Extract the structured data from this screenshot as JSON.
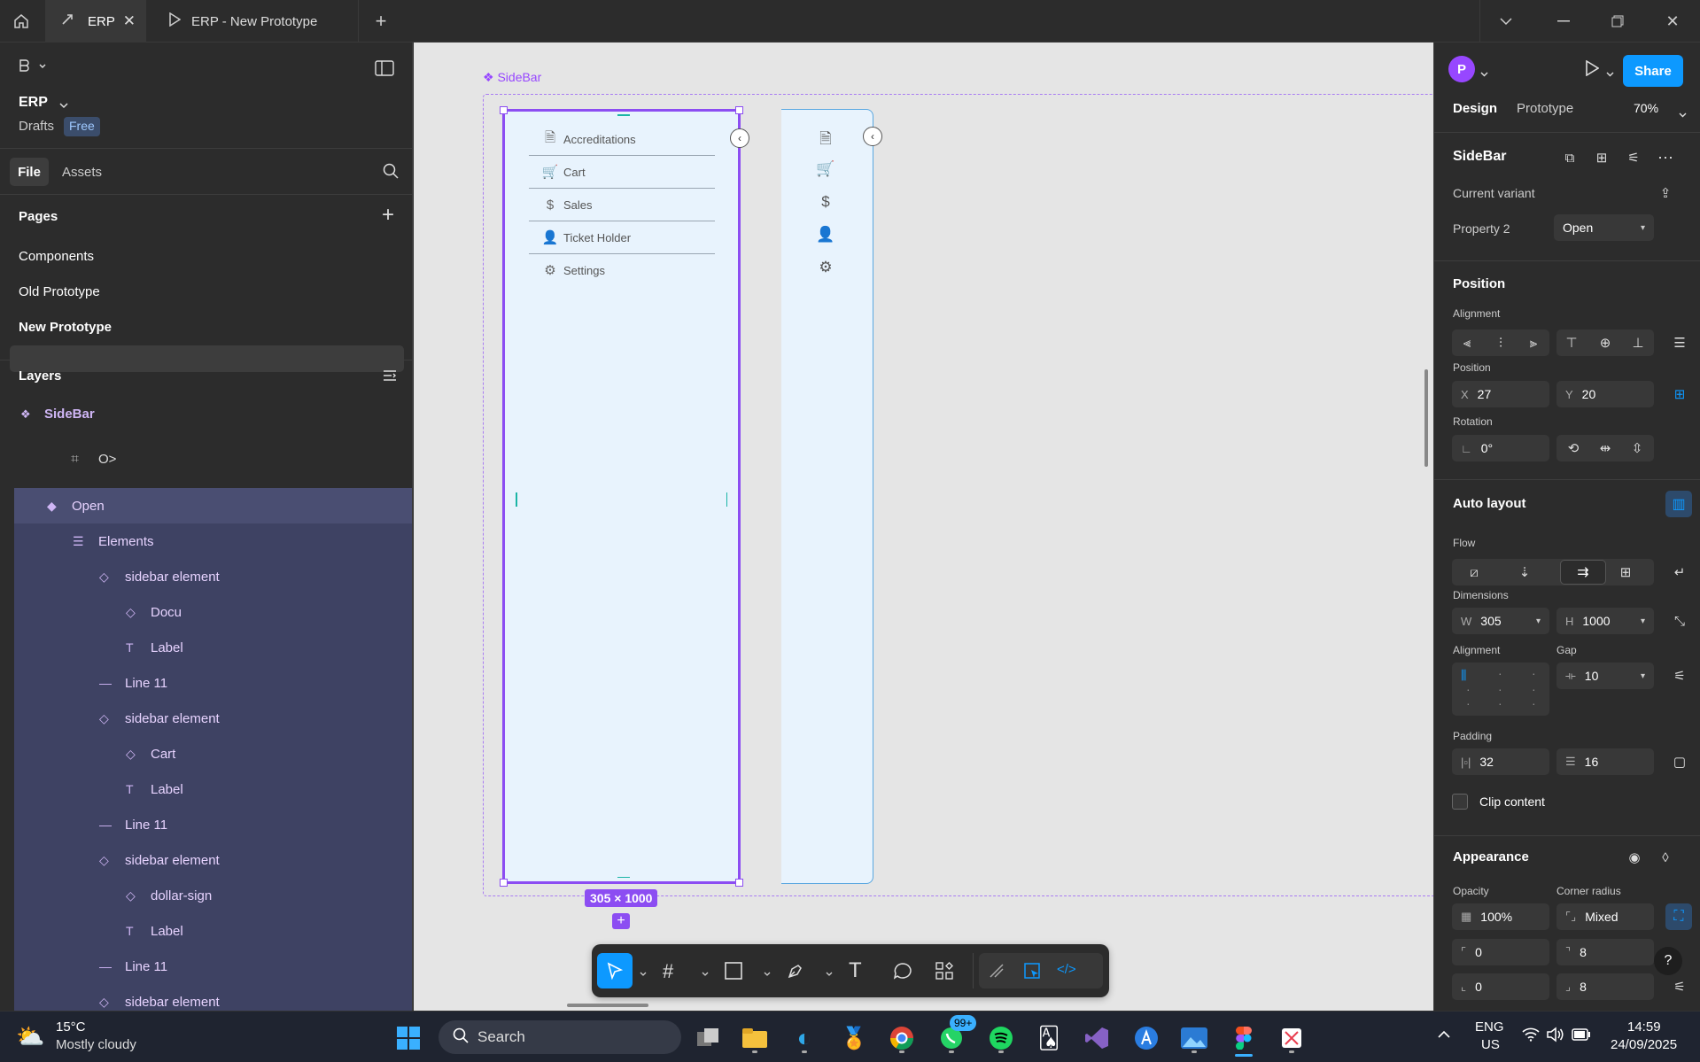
{
  "titlebar": {
    "tabs": [
      {
        "label": "ERP",
        "active": true
      },
      {
        "label": "ERP - New Prototype",
        "active": false
      }
    ]
  },
  "file": {
    "name": "ERP",
    "location": "Drafts",
    "plan_badge": "Free"
  },
  "left_tabs": {
    "file": "File",
    "assets": "Assets"
  },
  "pages": {
    "heading": "Pages",
    "items": [
      "Components",
      "Old Prototype",
      "New Prototype"
    ],
    "selected": "New Prototype"
  },
  "layers": {
    "heading": "Layers",
    "root": "SideBar",
    "items": [
      {
        "label": "O>",
        "icon": "frame-icon"
      },
      {
        "label": "Open",
        "icon": "component-icon"
      },
      {
        "label": "Elements",
        "icon": "autolayout-icon"
      },
      {
        "label": "sidebar element",
        "icon": "instance-icon"
      },
      {
        "label": "Docu",
        "icon": "instance-icon"
      },
      {
        "label": "Label",
        "icon": "text-icon"
      },
      {
        "label": "Line 11",
        "icon": "line-icon"
      },
      {
        "label": "sidebar element",
        "icon": "instance-icon"
      },
      {
        "label": "Cart",
        "icon": "instance-icon"
      },
      {
        "label": "Label",
        "icon": "text-icon"
      },
      {
        "label": "Line 11",
        "icon": "line-icon"
      },
      {
        "label": "sidebar element",
        "icon": "instance-icon"
      },
      {
        "label": "dollar-sign",
        "icon": "instance-icon"
      },
      {
        "label": "Label",
        "icon": "text-icon"
      },
      {
        "label": "Line 11",
        "icon": "line-icon"
      },
      {
        "label": "sidebar element",
        "icon": "instance-icon"
      }
    ]
  },
  "canvas": {
    "component_label": "SideBar",
    "open_items": [
      {
        "label": "Accreditations",
        "icon": "document-icon"
      },
      {
        "label": "Cart",
        "icon": "cart-icon"
      },
      {
        "label": "Sales",
        "icon": "dollar-icon"
      },
      {
        "label": "Ticket Holder",
        "icon": "user-icon"
      },
      {
        "label": "Settings",
        "icon": "gear-icon"
      }
    ],
    "size_badge": "305 × 1000"
  },
  "right": {
    "avatar_letter": "P",
    "share_label": "Share",
    "tabs": {
      "design": "Design",
      "prototype": "Prototype"
    },
    "zoom": "70%",
    "selection_name": "SideBar",
    "current_variant": "Current variant",
    "property_label": "Property 2",
    "property_value": "Open",
    "position_heading": "Position",
    "alignment_label": "Alignment",
    "position_label": "Position",
    "x": "27",
    "y": "20",
    "rotation_label": "Rotation",
    "rotation": "0°",
    "autolayout_heading": "Auto layout",
    "flow_label": "Flow",
    "dimensions_label": "Dimensions",
    "w": "305",
    "h": "1000",
    "alignment2_label": "Alignment",
    "gap_label": "Gap",
    "gap": "10",
    "padding_label": "Padding",
    "padding_h": "32",
    "padding_v": "16",
    "clip_content": "Clip content",
    "appearance_heading": "Appearance",
    "opacity_label": "Opacity",
    "opacity": "100%",
    "corner_label": "Corner radius",
    "corner": "Mixed",
    "r_tl": "0",
    "r_tr": "8",
    "r_bl": "0",
    "r_br": "8"
  },
  "taskbar": {
    "temp": "15°C",
    "weather": "Mostly cloudy",
    "search": "Search",
    "notif_badge": "99+",
    "lang": "ENG",
    "region": "US",
    "time": "14:59",
    "date": "24/09/2025"
  },
  "colors": {
    "accent": "#0d99ff",
    "component_purple": "#9747ff",
    "layer_highlight": "#3e4263",
    "frame_fill": "#e8f3fd"
  }
}
